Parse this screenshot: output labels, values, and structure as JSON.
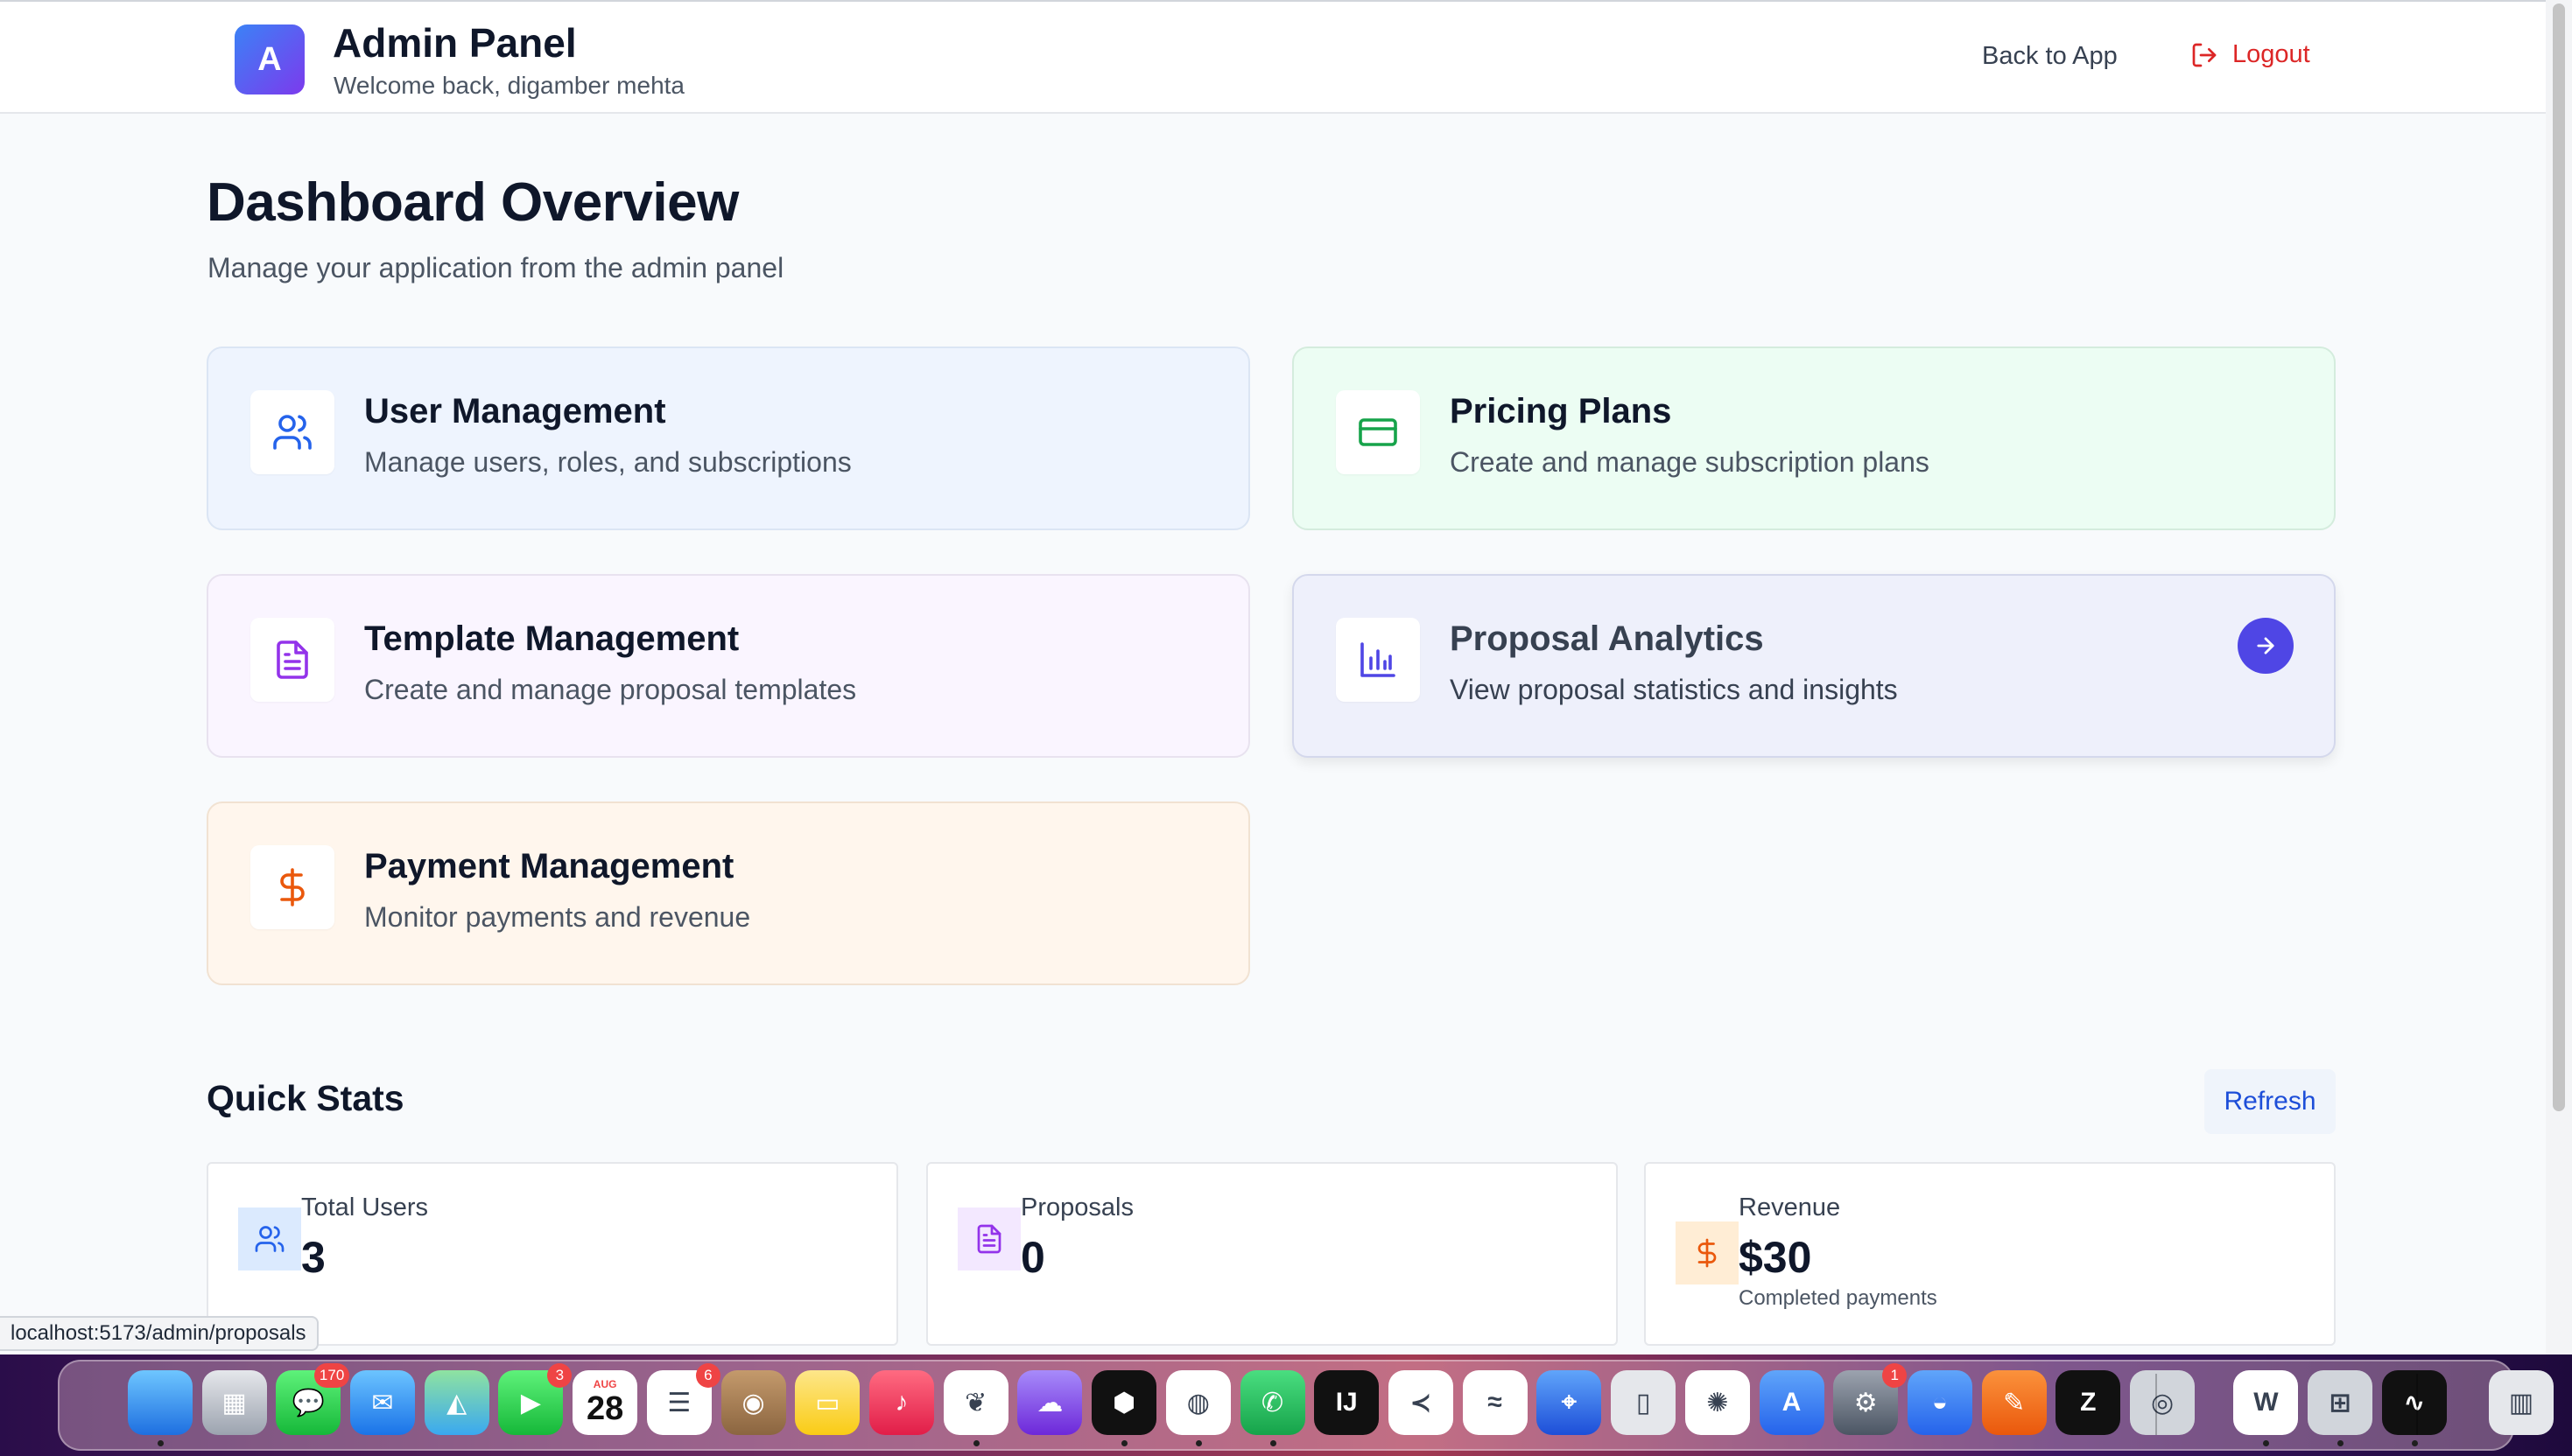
{
  "header": {
    "logo_letter": "A",
    "title": "Admin Panel",
    "welcome": "Welcome back, digamber mehta",
    "back_label": "Back to App",
    "logout_label": "Logout"
  },
  "page": {
    "title": "Dashboard Overview",
    "subtitle": "Manage your application from the admin panel"
  },
  "cards": [
    {
      "title": "User Management",
      "desc": "Manage users, roles, and subscriptions",
      "icon": "users-icon",
      "color": "#2563eb"
    },
    {
      "title": "Pricing Plans",
      "desc": "Create and manage subscription plans",
      "icon": "credit-card-icon",
      "color": "#16a34a"
    },
    {
      "title": "Template Management",
      "desc": "Create and manage proposal templates",
      "icon": "file-text-icon",
      "color": "#9333ea"
    },
    {
      "title": "Proposal Analytics",
      "desc": "View proposal statistics and insights",
      "icon": "bar-chart-icon",
      "color": "#4f46e5"
    },
    {
      "title": "Payment Management",
      "desc": "Monitor payments and revenue",
      "icon": "dollar-icon",
      "color": "#ea580c"
    }
  ],
  "quick_stats": {
    "title": "Quick Stats",
    "refresh_label": "Refresh",
    "items": [
      {
        "label": "Total Users",
        "value": "3",
        "icon": "users-icon"
      },
      {
        "label": "Proposals",
        "value": "0",
        "icon": "file-text-icon"
      },
      {
        "label": "Revenue",
        "value": "$30",
        "note": "Completed payments",
        "icon": "dollar-icon"
      }
    ]
  },
  "status_bar": {
    "url": "localhost:5173/admin/proposals"
  },
  "dock": {
    "apps": [
      {
        "name": "Finder",
        "badge": ""
      },
      {
        "name": "Launchpad",
        "badge": ""
      },
      {
        "name": "Messages",
        "badge": "170"
      },
      {
        "name": "Mail",
        "badge": ""
      },
      {
        "name": "Maps",
        "badge": ""
      },
      {
        "name": "FaceTime",
        "badge": "3"
      },
      {
        "name": "Calendar",
        "badge": "",
        "month": "AUG",
        "day": "28"
      },
      {
        "name": "Reminders",
        "badge": "6"
      },
      {
        "name": "Contacts",
        "badge": ""
      },
      {
        "name": "Notes",
        "badge": ""
      },
      {
        "name": "Music",
        "badge": ""
      },
      {
        "name": "MongoDB Compass",
        "badge": ""
      },
      {
        "name": "Ghostty",
        "badge": ""
      },
      {
        "name": "Cursor",
        "badge": ""
      },
      {
        "name": "Chrome",
        "badge": ""
      },
      {
        "name": "WhatsApp",
        "badge": ""
      },
      {
        "name": "IntelliJ",
        "badge": ""
      },
      {
        "name": "VS Code",
        "badge": ""
      },
      {
        "name": "Freeform",
        "badge": ""
      },
      {
        "name": "Safari",
        "badge": ""
      },
      {
        "name": "iPhone Mirroring",
        "badge": ""
      },
      {
        "name": "ChatGPT",
        "badge": ""
      },
      {
        "name": "App Store",
        "badge": ""
      },
      {
        "name": "System Settings",
        "badge": "1"
      },
      {
        "name": "Docker",
        "badge": ""
      },
      {
        "name": "Pencil",
        "badge": ""
      },
      {
        "name": "Zed",
        "badge": ""
      },
      {
        "name": "QuickTime",
        "badge": ""
      },
      {
        "name": "Word",
        "badge": ""
      },
      {
        "name": "Calculator",
        "badge": ""
      },
      {
        "name": "Activity Monitor",
        "badge": ""
      },
      {
        "name": "Trash",
        "badge": ""
      }
    ]
  }
}
